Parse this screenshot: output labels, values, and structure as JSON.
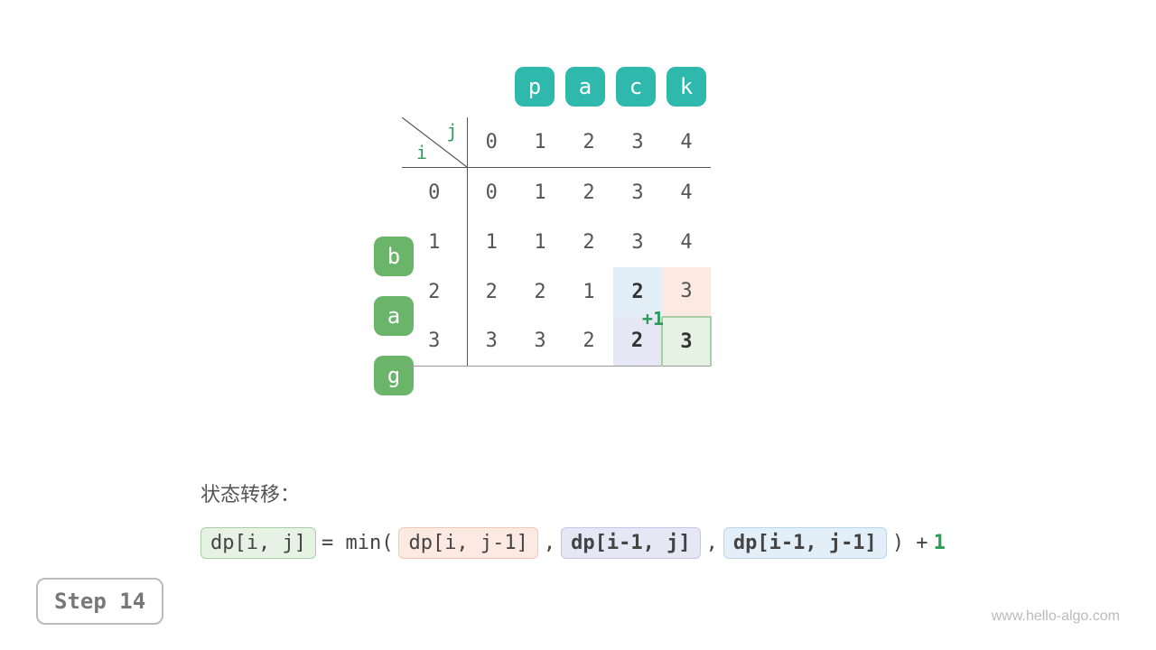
{
  "chart_data": {
    "type": "table",
    "description": "Edit distance DP table (i rows = source chars, j cols = target chars)",
    "source": "bag",
    "target": "pack",
    "i_labels": [
      "0",
      "1",
      "2",
      "3"
    ],
    "j_labels": [
      "0",
      "1",
      "2",
      "3",
      "4"
    ],
    "grid": [
      [
        0,
        1,
        2,
        3,
        4
      ],
      [
        1,
        1,
        2,
        3,
        4
      ],
      [
        2,
        2,
        1,
        2,
        3
      ],
      [
        3,
        3,
        2,
        2,
        3
      ]
    ],
    "highlights": {
      "blue": {
        "i": 2,
        "j": 3
      },
      "peach": {
        "i": 2,
        "j": 4
      },
      "lavender": {
        "i": 3,
        "j": 3
      },
      "green": {
        "i": 3,
        "j": 4
      }
    },
    "increment_label": "+1",
    "transition": "dp[i, j] = min(dp[i, j-1], dp[i-1, j], dp[i-1, j-1]) + 1"
  },
  "top_letters": [
    "p",
    "a",
    "c",
    "k"
  ],
  "left_letters": [
    "b",
    "a",
    "g"
  ],
  "axis": {
    "i": "i",
    "j": "j"
  },
  "j_hdr": [
    "0",
    "1",
    "2",
    "3",
    "4"
  ],
  "rows": [
    {
      "idx": "0",
      "cells": [
        {
          "v": "0"
        },
        {
          "v": "1"
        },
        {
          "v": "2"
        },
        {
          "v": "3"
        },
        {
          "v": "4"
        }
      ]
    },
    {
      "idx": "1",
      "cells": [
        {
          "v": "1"
        },
        {
          "v": "1"
        },
        {
          "v": "2"
        },
        {
          "v": "3"
        },
        {
          "v": "4"
        }
      ]
    },
    {
      "idx": "2",
      "cells": [
        {
          "v": "2"
        },
        {
          "v": "2"
        },
        {
          "v": "1"
        },
        {
          "v": "2",
          "cls": "hl hl-blue bold",
          "plus": "+1"
        },
        {
          "v": "3",
          "cls": "hl hl-peach"
        }
      ]
    },
    {
      "idx": "3",
      "last": true,
      "cells": [
        {
          "v": "3"
        },
        {
          "v": "3"
        },
        {
          "v": "2"
        },
        {
          "v": "2",
          "cls": "hl hl-lav bold"
        },
        {
          "v": "3",
          "cls": "hl hl-green bold"
        }
      ]
    }
  ],
  "formula": {
    "label": "状态转移：",
    "lhs": "dp[i, j]",
    "eq": " = min( ",
    "t1": "dp[i, j-1]",
    "c1": " , ",
    "t2": "dp[i-1, j]",
    "c2": " , ",
    "t3": "dp[i-1, j-1]",
    "close": " ) + ",
    "one": "1"
  },
  "step": "Step 14",
  "watermark": "www.hello-algo.com"
}
